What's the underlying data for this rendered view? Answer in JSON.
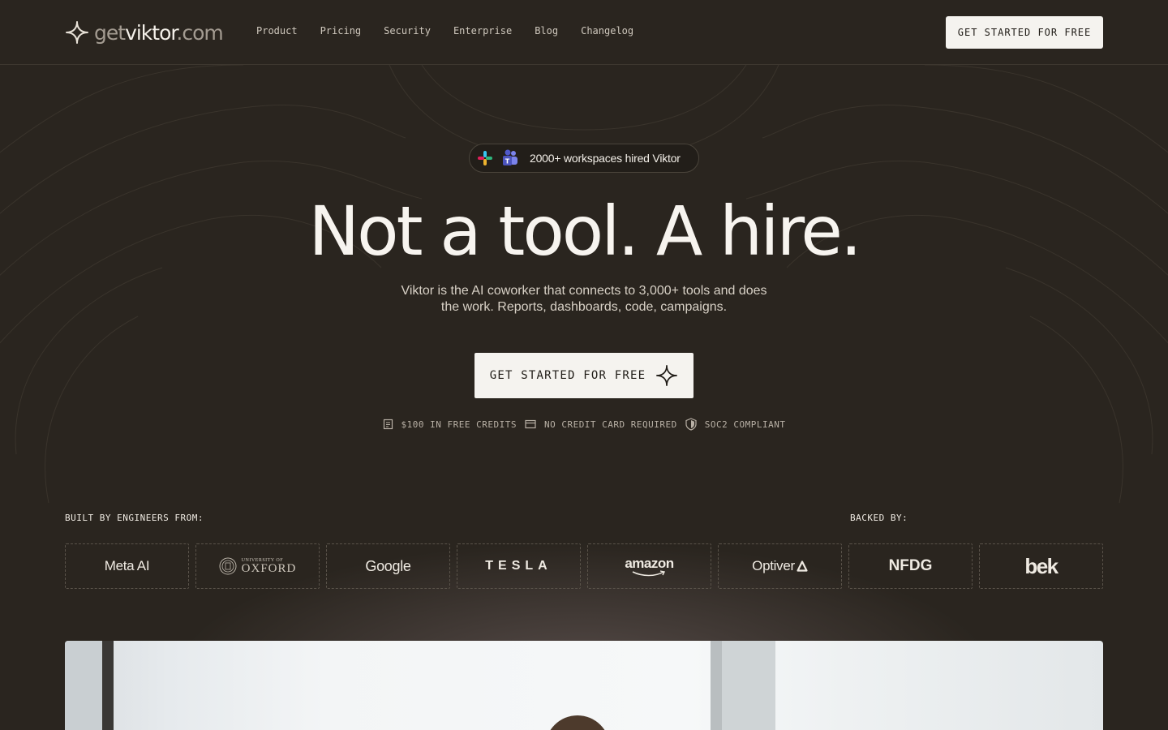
{
  "nav": {
    "logo": {
      "prefix": "get",
      "name": "viktor",
      "suffix": ".com"
    },
    "links": [
      "Product",
      "Pricing",
      "Security",
      "Enterprise",
      "Blog",
      "Changelog"
    ],
    "cta_label": "GET STARTED FOR FREE"
  },
  "hero": {
    "badge": {
      "text": "2000+ workspaces hired Viktor",
      "icons": [
        "slack-icon",
        "teams-icon"
      ]
    },
    "title": "Not a tool. A hire.",
    "subtitle_line1": "Viktor is the AI coworker that connects to 3,000+ tools and does",
    "subtitle_line2": "the work. Reports, dashboards, code, campaigns.",
    "cta_label": "GET STARTED FOR FREE",
    "features": [
      {
        "icon": "receipt-icon",
        "text": "$100 IN FREE CREDITS"
      },
      {
        "icon": "credit-card-icon",
        "text": "NO CREDIT CARD REQUIRED"
      },
      {
        "icon": "shield-icon",
        "text": "SOC2 COMPLIANT"
      }
    ]
  },
  "logos": {
    "built_label": "BUILT BY ENGINEERS FROM:",
    "backed_label": "BACKED BY:",
    "items": {
      "meta": "Meta AI",
      "oxford_small": "UNIVERSITY OF",
      "oxford_big": "OXFORD",
      "google": "Google",
      "tesla": "TESLA",
      "amazon": "amazon",
      "optiver": "Optiver",
      "nfdg": "NFDG",
      "bek": "bek"
    }
  },
  "colors": {
    "background": "#2a251f",
    "button_bg": "#f5f3ef",
    "text": "#f3efe8",
    "muted": "#b9b1a6"
  }
}
